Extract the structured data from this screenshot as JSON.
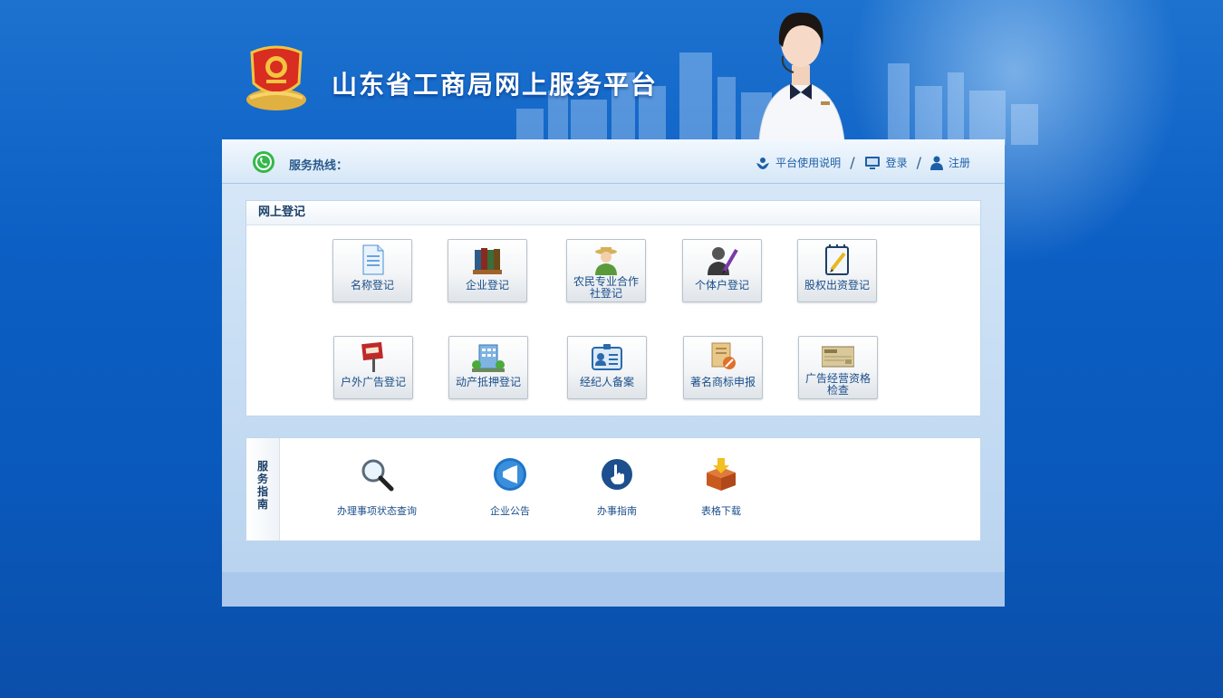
{
  "header": {
    "title": "山东省工商局网上服务平台"
  },
  "topbar": {
    "hotline_label": "服务热线：",
    "links": [
      {
        "label": "平台使用说明",
        "icon": "help-hands-icon"
      },
      {
        "label": "登录",
        "icon": "monitor-icon"
      },
      {
        "label": "注册",
        "icon": "user-icon"
      }
    ],
    "separator": "/"
  },
  "registration": {
    "heading": "网上登记",
    "tiles": [
      {
        "label": "名称登记",
        "icon": "document-icon"
      },
      {
        "label": "企业登记",
        "icon": "books-icon"
      },
      {
        "label": "农民专业合作社登记",
        "line1": "农民专业合作",
        "line2": "社登记",
        "icon": "farmer-icon"
      },
      {
        "label": "个体户登记",
        "icon": "person-pen-icon"
      },
      {
        "label": "股权出资登记",
        "icon": "notepad-pencil-icon"
      },
      {
        "label": "户外广告登记",
        "icon": "billboard-icon"
      },
      {
        "label": "动产抵押登记",
        "icon": "building-icon"
      },
      {
        "label": "经纪人备案",
        "icon": "id-card-icon"
      },
      {
        "label": "著名商标申报",
        "icon": "trademark-icon"
      },
      {
        "label": "广告经营资格检查",
        "line1": "广告经营资格",
        "line2": "检查",
        "icon": "check-icon"
      }
    ]
  },
  "guide": {
    "side_label": [
      "服",
      "务",
      "指",
      "南"
    ],
    "items": [
      {
        "label": "办理事项状态查询",
        "icon": "magnifier-icon"
      },
      {
        "label": "企业公告",
        "icon": "megaphone-icon"
      },
      {
        "label": "办事指南",
        "icon": "hand-pointer-icon"
      },
      {
        "label": "表格下载",
        "icon": "download-box-icon"
      }
    ]
  },
  "colors": {
    "background": "#0c5fc4",
    "accent": "#1a4e8a",
    "panel": "#c8def4"
  }
}
